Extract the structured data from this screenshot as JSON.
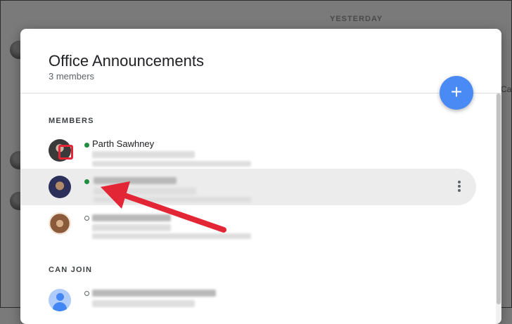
{
  "background": {
    "date_label": "YESTERDAY",
    "edge_text": "Ca"
  },
  "dialog": {
    "title": "Office Announcements",
    "subtitle": "3 members",
    "add_button_label": "+"
  },
  "sections": {
    "members_label": "MEMBERS",
    "can_join_label": "CAN JOIN"
  },
  "members": [
    {
      "name": "Parth Sawhney",
      "status": "online",
      "icon": "avatar-photo"
    },
    {
      "name": "",
      "status": "online",
      "icon": "avatar-photo",
      "highlighted": true
    },
    {
      "name": "",
      "status": "offline",
      "icon": "avatar-photo"
    }
  ],
  "can_join": [
    {
      "name": "",
      "status": "offline",
      "icon": "person-icon"
    }
  ],
  "colors": {
    "online": "#1e8e3e",
    "fab": "#4a8af4",
    "callout": "#e32636"
  }
}
